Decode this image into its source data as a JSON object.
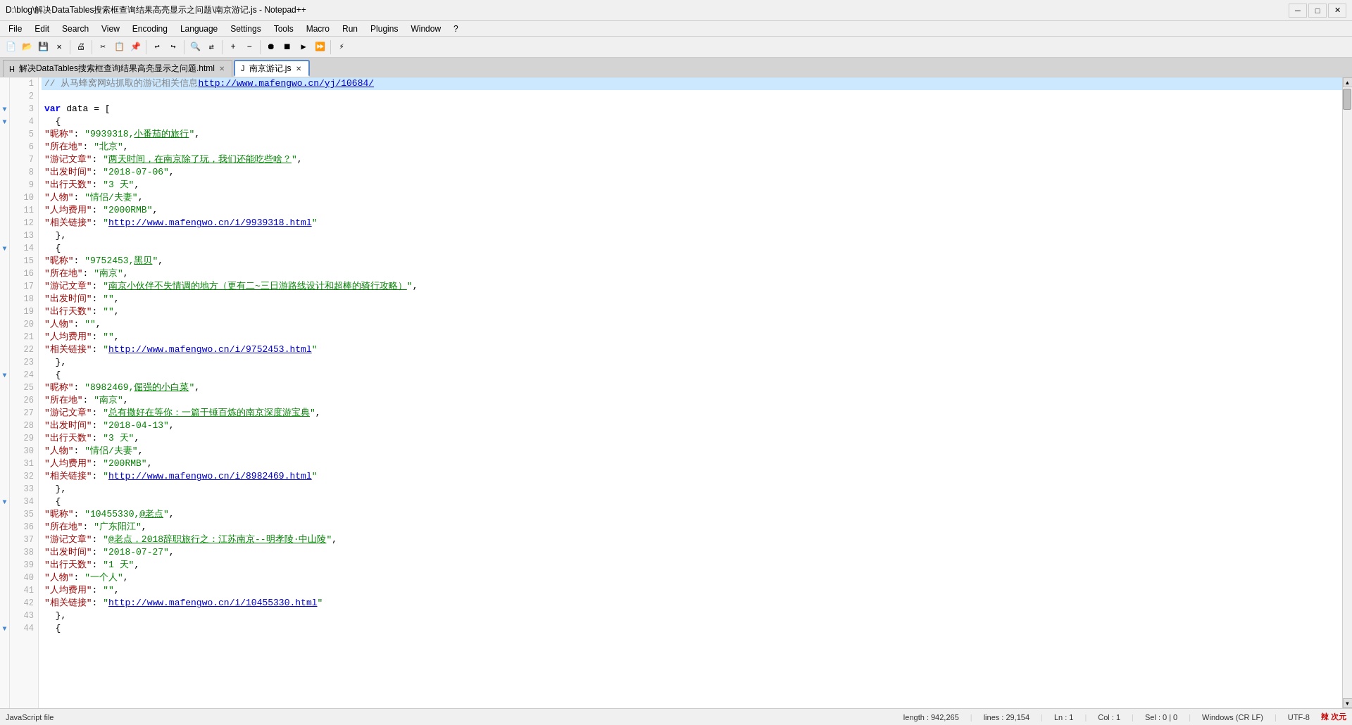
{
  "titleBar": {
    "title": "D:\\blog\\解决DataTables搜索框查询结果高亮显示之问题\\南京游记.js - Notepad++",
    "minimize": "─",
    "maximize": "□",
    "close": "✕"
  },
  "menuBar": {
    "items": [
      "File",
      "Edit",
      "Search",
      "View",
      "Encoding",
      "Language",
      "Settings",
      "Tools",
      "Macro",
      "Run",
      "Plugins",
      "Window",
      "?"
    ]
  },
  "tabs": [
    {
      "id": "tab1",
      "label": "解决DataTables搜索框查询结果高亮显示之问题.html",
      "active": false
    },
    {
      "id": "tab2",
      "label": "南京游记.js",
      "active": true
    }
  ],
  "statusBar": {
    "fileType": "JavaScript file",
    "length": "length : 942,265",
    "lines": "lines : 29,154",
    "ln": "Ln : 1",
    "col": "Col : 1",
    "sel": "Sel : 0 | 0",
    "lineEnding": "Windows (CR LF)",
    "encoding": "UTF-8"
  },
  "code": {
    "lines": [
      {
        "num": 1,
        "collapse": "",
        "content": "// 从马蜂窝网站抓取的游记相关信息http://www.mafengwo.cn/yj/10684/",
        "type": "comment"
      },
      {
        "num": 2,
        "collapse": "",
        "content": "",
        "type": "empty"
      },
      {
        "num": 3,
        "collapse": "▼",
        "content": "var data = [",
        "type": "code"
      },
      {
        "num": 4,
        "collapse": "▼",
        "content": "  {",
        "type": "code"
      },
      {
        "num": 5,
        "collapse": "",
        "content": "    \"昵称\": \"9939318,小番茄的旅行\",",
        "type": "code"
      },
      {
        "num": 6,
        "collapse": "",
        "content": "    \"所在地\": \"北京\",",
        "type": "code"
      },
      {
        "num": 7,
        "collapse": "",
        "content": "    \"游记文章\": \"两天时间，在南京除了玩，我们还能吃些啥？\",",
        "type": "code"
      },
      {
        "num": 8,
        "collapse": "",
        "content": "    \"出发时间\": \"2018-07-06\",",
        "type": "code"
      },
      {
        "num": 9,
        "collapse": "",
        "content": "    \"出行天数\": \"3 天\",",
        "type": "code"
      },
      {
        "num": 10,
        "collapse": "",
        "content": "    \"人物\": \"情侣/夫妻\",",
        "type": "code"
      },
      {
        "num": 11,
        "collapse": "",
        "content": "    \"人均费用\": \"2000RMB\",",
        "type": "code"
      },
      {
        "num": 12,
        "collapse": "",
        "content": "    \"相关链接\": \"http://www.mafengwo.cn/i/9939318.html\"",
        "type": "code"
      },
      {
        "num": 13,
        "collapse": "",
        "content": "  },",
        "type": "code"
      },
      {
        "num": 14,
        "collapse": "▼",
        "content": "  {",
        "type": "code"
      },
      {
        "num": 15,
        "collapse": "",
        "content": "    \"昵称\": \"9752453,黑贝\",",
        "type": "code"
      },
      {
        "num": 16,
        "collapse": "",
        "content": "    \"所在地\": \"南京\",",
        "type": "code"
      },
      {
        "num": 17,
        "collapse": "",
        "content": "    \"游记文章\": \"南京小伙伴不失情调的地方（更有二~三日游路线设计和超棒的骑行攻略）\",",
        "type": "code"
      },
      {
        "num": 18,
        "collapse": "",
        "content": "    \"出发时间\": \"\",",
        "type": "code"
      },
      {
        "num": 19,
        "collapse": "",
        "content": "    \"出行天数\": \"\",",
        "type": "code"
      },
      {
        "num": 20,
        "collapse": "",
        "content": "    \"人物\": \"\",",
        "type": "code"
      },
      {
        "num": 21,
        "collapse": "",
        "content": "    \"人均费用\": \"\",",
        "type": "code"
      },
      {
        "num": 22,
        "collapse": "",
        "content": "    \"相关链接\": \"http://www.mafengwo.cn/i/9752453.html\"",
        "type": "code"
      },
      {
        "num": 23,
        "collapse": "",
        "content": "  },",
        "type": "code"
      },
      {
        "num": 24,
        "collapse": "▼",
        "content": "  {",
        "type": "code"
      },
      {
        "num": 25,
        "collapse": "",
        "content": "    \"昵称\": \"8982469,倔强的小白菜\",",
        "type": "code"
      },
      {
        "num": 26,
        "collapse": "",
        "content": "    \"所在地\": \"南京\",",
        "type": "code"
      },
      {
        "num": 27,
        "collapse": "",
        "content": "    \"游记文章\": \"总有撒好在等你：一篇干锤百炼的南京深度游宝典\",",
        "type": "code"
      },
      {
        "num": 28,
        "collapse": "",
        "content": "    \"出发时间\": \"2018-04-13\",",
        "type": "code"
      },
      {
        "num": 29,
        "collapse": "",
        "content": "    \"出行天数\": \"3 天\",",
        "type": "code"
      },
      {
        "num": 30,
        "collapse": "",
        "content": "    \"人物\": \"情侣/夫妻\",",
        "type": "code"
      },
      {
        "num": 31,
        "collapse": "",
        "content": "    \"人均费用\": \"200RMB\",",
        "type": "code"
      },
      {
        "num": 32,
        "collapse": "",
        "content": "    \"相关链接\": \"http://www.mafengwo.cn/i/8982469.html\"",
        "type": "code"
      },
      {
        "num": 33,
        "collapse": "",
        "content": "  },",
        "type": "code"
      },
      {
        "num": 34,
        "collapse": "▼",
        "content": "  {",
        "type": "code"
      },
      {
        "num": 35,
        "collapse": "",
        "content": "    \"昵称\": \"10455330,@老点\",",
        "type": "code"
      },
      {
        "num": 36,
        "collapse": "",
        "content": "    \"所在地\": \"广东阳江\",",
        "type": "code"
      },
      {
        "num": 37,
        "collapse": "",
        "content": "    \"游记文章\": \"@老点，2018辞职旅行之：江苏南京--明孝陵·中山陵\",",
        "type": "code"
      },
      {
        "num": 38,
        "collapse": "",
        "content": "    \"出发时间\": \"2018-07-27\",",
        "type": "code"
      },
      {
        "num": 39,
        "collapse": "",
        "content": "    \"出行天数\": \"1 天\",",
        "type": "code"
      },
      {
        "num": 40,
        "collapse": "",
        "content": "    \"人物\": \"一个人\",",
        "type": "code"
      },
      {
        "num": 41,
        "collapse": "",
        "content": "    \"人均费用\": \"\",",
        "type": "code"
      },
      {
        "num": 42,
        "collapse": "",
        "content": "    \"相关链接\": \"http://www.mafengwo.cn/i/10455330.html\"",
        "type": "code"
      },
      {
        "num": 43,
        "collapse": "",
        "content": "  },",
        "type": "code"
      },
      {
        "num": 44,
        "collapse": "▼",
        "content": "  {",
        "type": "code"
      }
    ]
  }
}
